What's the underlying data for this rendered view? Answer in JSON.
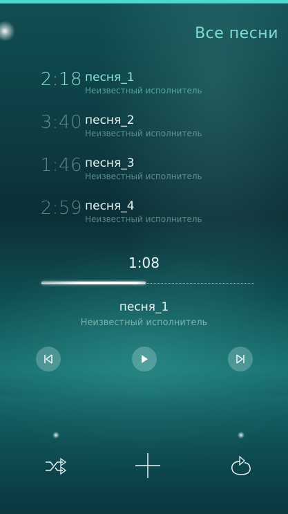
{
  "header": {
    "title": "Все песни"
  },
  "tracks": [
    {
      "duration": "2:18",
      "title": "песня_1",
      "artist": "Неизвестный исполнитель",
      "current": true
    },
    {
      "duration": "3:40",
      "title": "песня_2",
      "artist": "Неизвестный исполнитель",
      "current": false
    },
    {
      "duration": "1:46",
      "title": "песня_3",
      "artist": "Неизвестный исполнитель",
      "current": false
    },
    {
      "duration": "2:59",
      "title": "песня_4",
      "artist": "Неизвестный исполнитель",
      "current": false
    }
  ],
  "player": {
    "elapsed": "1:08",
    "progress_fraction": 0.49,
    "now_playing_title": "песня_1",
    "now_playing_artist": "Неизвестный исполнитель",
    "controls": [
      "previous-icon",
      "play-icon",
      "next-icon"
    ]
  },
  "bottom_bar": {
    "icons": [
      "shuffle-icon",
      "add-icon",
      "repeat-icon"
    ]
  },
  "colors": {
    "accent": "#7fdcd3",
    "top_strip": "#4fd6cf",
    "background": "#0d3a3d"
  }
}
